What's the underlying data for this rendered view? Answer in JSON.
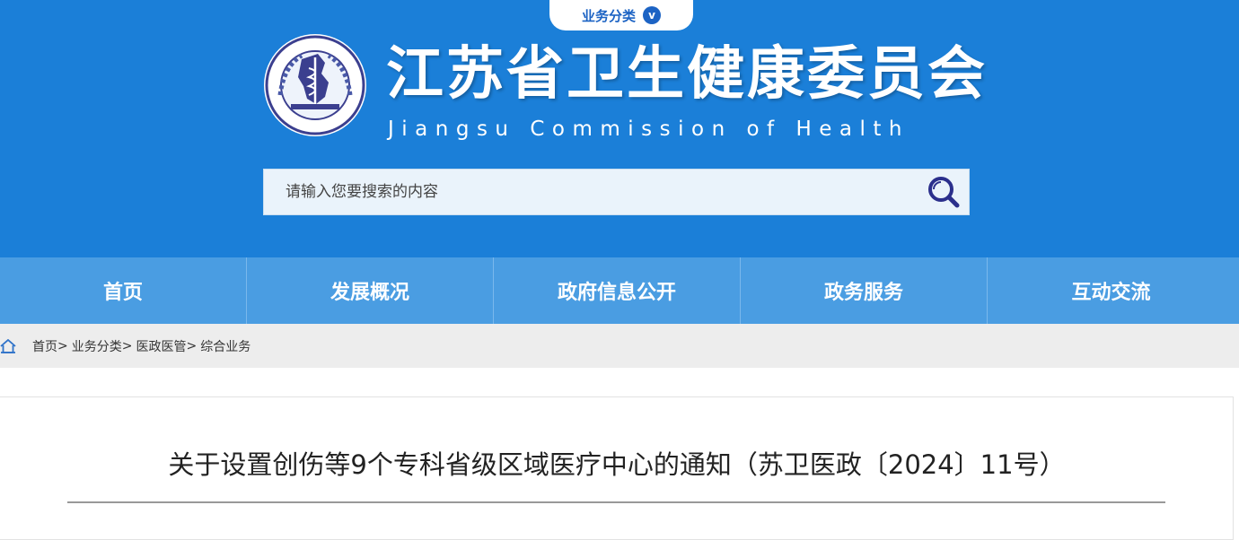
{
  "header": {
    "category_tab": "业务分类",
    "category_tab_badge": "v",
    "title_cn": "江苏省卫生健康委员会",
    "title_en": "Jiangsu Commission of Health",
    "logo_seal_text": "江苏省卫生健康委员会 Jiangsu Commission of Health",
    "bg_color": "#1b7fd8",
    "accent_color": "#1c63c4"
  },
  "search": {
    "placeholder": "请输入您要搜索的内容",
    "value": "",
    "icon": "search-icon"
  },
  "nav": {
    "items": [
      {
        "label": "首页"
      },
      {
        "label": "发展概况"
      },
      {
        "label": "政府信息公开"
      },
      {
        "label": "政务服务"
      },
      {
        "label": "互动交流"
      }
    ]
  },
  "breadcrumb": {
    "icon": "home-icon",
    "items": [
      {
        "label": "首页"
      },
      {
        "label": "业务分类"
      },
      {
        "label": "医政医管"
      },
      {
        "label": "综合业务"
      }
    ],
    "separator": ">"
  },
  "article": {
    "title": "关于设置创伤等9个专科省级区域医疗中心的通知（苏卫医政〔2024〕11号）"
  }
}
